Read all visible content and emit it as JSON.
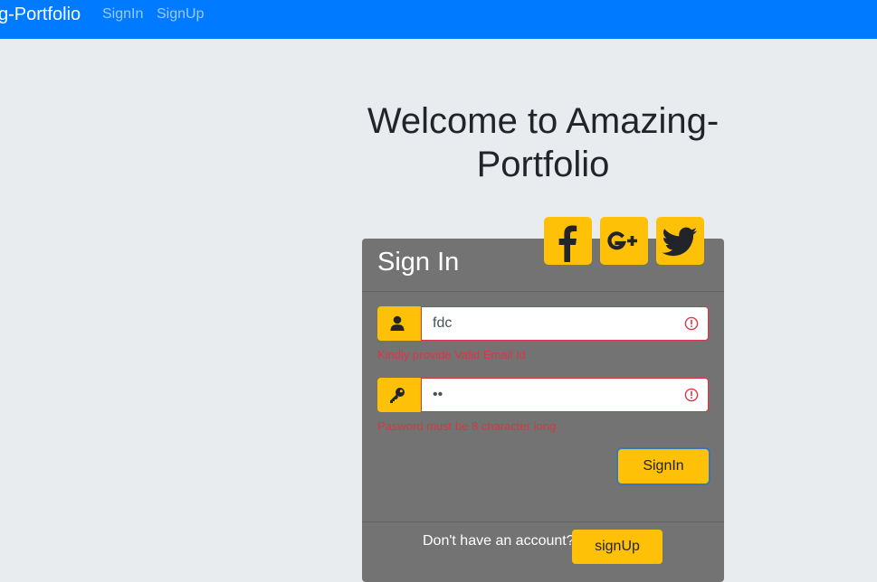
{
  "navbar": {
    "brand": "g-Portfolio",
    "links": [
      "SignIn",
      "SignUp"
    ]
  },
  "welcome": {
    "title": "Welcome to Amazing-Portfolio"
  },
  "card": {
    "title": "Sign In",
    "social_icons": [
      "facebook-icon",
      "google-plus-icon",
      "twitter-icon"
    ],
    "email": {
      "value": "fdc",
      "icon": "user-icon",
      "error": "Kindly provide Valid Email Id"
    },
    "password": {
      "masked_value": "••",
      "icon": "key-icon",
      "error": "Pasword must be 8 character long"
    },
    "signin_button": "SignIn",
    "footer_text": "Don't have an account?",
    "signup_button": "signUp"
  },
  "colors": {
    "navbar": "#007bff",
    "accent": "#ffc107",
    "card": "#737373",
    "error": "#dc3545",
    "background": "#e9ecef"
  }
}
